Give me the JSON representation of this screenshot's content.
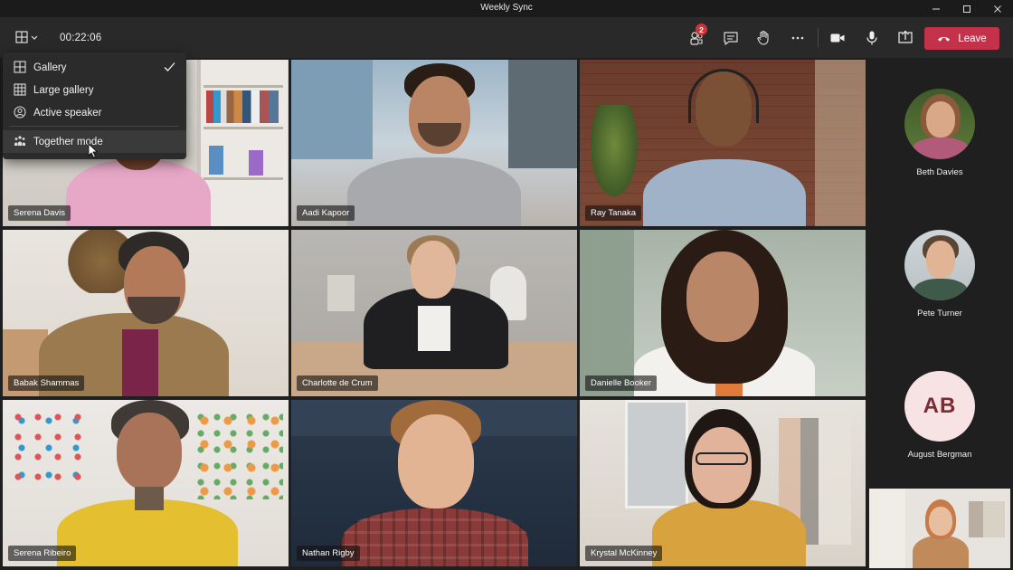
{
  "window": {
    "title": "Weekly Sync",
    "controls": [
      "minimize-icon",
      "maximize-icon",
      "close-icon"
    ]
  },
  "toolbar": {
    "layout_icon": "grid-icon",
    "timer": "00:22:06",
    "participants_badge": "2",
    "actions": [
      "participants-icon",
      "chat-icon",
      "raise-hand-icon",
      "more-icon",
      "camera-icon",
      "mic-icon",
      "share-icon"
    ],
    "leave_label": "Leave",
    "leave_color": "#c4314b"
  },
  "layout_menu": {
    "items": [
      {
        "label": "Gallery",
        "icon": "gallery-icon",
        "checked": true
      },
      {
        "label": "Large gallery",
        "icon": "large-gallery-icon",
        "checked": false
      },
      {
        "label": "Active speaker",
        "icon": "active-speaker-icon",
        "checked": false
      },
      {
        "label": "Together mode",
        "icon": "together-mode-icon",
        "checked": false
      }
    ]
  },
  "tiles": [
    {
      "name": "Serena Davis"
    },
    {
      "name": "Aadi Kapoor"
    },
    {
      "name": "Ray Tanaka"
    },
    {
      "name": "Babak Shammas"
    },
    {
      "name": "Charlotte de Crum"
    },
    {
      "name": "Danielle Booker"
    },
    {
      "name": "Serena Ribeiro"
    },
    {
      "name": "Nathan Rigby"
    },
    {
      "name": "Krystal McKinney"
    }
  ],
  "rail": [
    {
      "name": "Beth Davies",
      "type": "photo"
    },
    {
      "name": "Pete Turner",
      "type": "photo"
    },
    {
      "name": "August Bergman",
      "type": "initials",
      "initials": "AB"
    }
  ]
}
